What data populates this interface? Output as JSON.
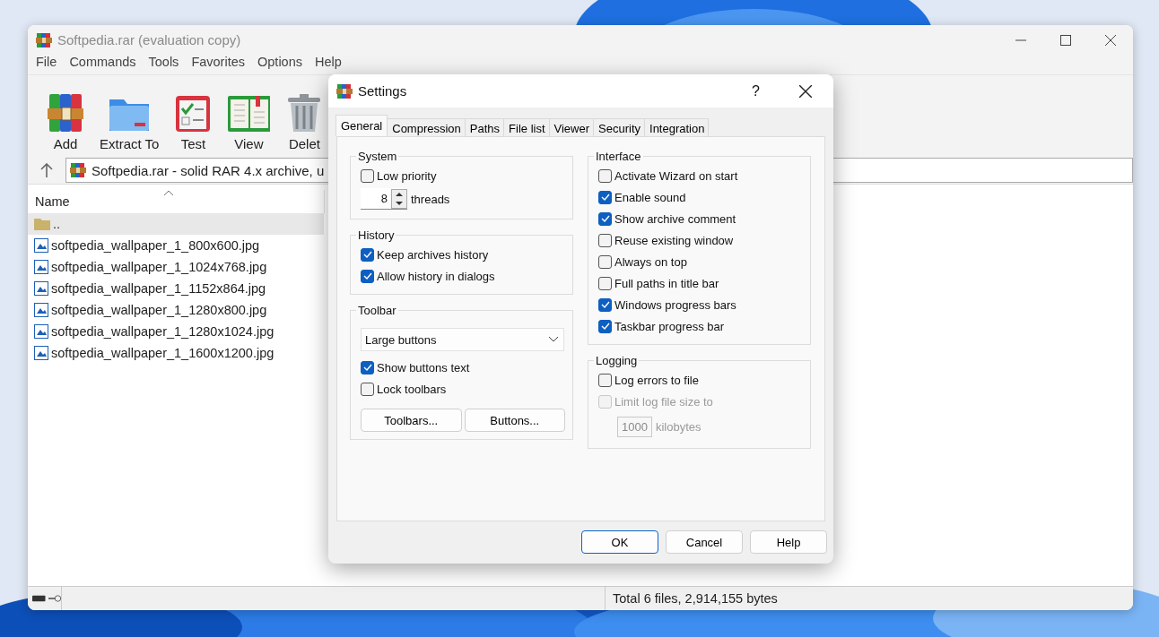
{
  "main_window": {
    "title": "Softpedia.rar (evaluation copy)",
    "menu": [
      "File",
      "Commands",
      "Tools",
      "Favorites",
      "Options",
      "Help"
    ],
    "toolbar": [
      {
        "label": "Add",
        "kind": "add"
      },
      {
        "label": "Extract To",
        "kind": "extract"
      },
      {
        "label": "Test",
        "kind": "test"
      },
      {
        "label": "View",
        "kind": "view"
      },
      {
        "label": "Delet",
        "kind": "delete"
      }
    ],
    "address": "Softpedia.rar - solid RAR 4.x archive, u",
    "columns": [
      "Name"
    ],
    "files": [
      {
        "name": "..",
        "kind": "folder",
        "selected": true
      },
      {
        "name": "softpedia_wallpaper_1_800x600.jpg",
        "kind": "image",
        "selected": false
      },
      {
        "name": "softpedia_wallpaper_1_1024x768.jpg",
        "kind": "image",
        "selected": false
      },
      {
        "name": "softpedia_wallpaper_1_1152x864.jpg",
        "kind": "image",
        "selected": false
      },
      {
        "name": "softpedia_wallpaper_1_1280x800.jpg",
        "kind": "image",
        "selected": false
      },
      {
        "name": "softpedia_wallpaper_1_1280x1024.jpg",
        "kind": "image",
        "selected": false
      },
      {
        "name": "softpedia_wallpaper_1_1600x1200.jpg",
        "kind": "image",
        "selected": false
      }
    ],
    "status": "Total 6 files, 2,914,155 bytes"
  },
  "dialog": {
    "title": "Settings",
    "help": "?",
    "tabs": [
      {
        "label": "General",
        "selected": true
      },
      {
        "label": "Compression",
        "selected": false
      },
      {
        "label": "Paths",
        "selected": false
      },
      {
        "label": "File list",
        "selected": false
      },
      {
        "label": "Viewer",
        "selected": false
      },
      {
        "label": "Security",
        "selected": false
      },
      {
        "label": "Integration",
        "selected": false
      }
    ],
    "columns": [
      {
        "groups": [
          {
            "title": "System",
            "items": [
              {
                "kind": "check",
                "label": "Low priority",
                "checked": false,
                "disabled": false
              },
              {
                "kind": "spin",
                "value": "8",
                "label": "threads"
              }
            ]
          },
          {
            "title": "History",
            "items": [
              {
                "kind": "check",
                "label": "Keep archives history",
                "checked": true,
                "disabled": false
              },
              {
                "kind": "check",
                "label": "Allow history in dialogs",
                "checked": true,
                "disabled": false
              }
            ]
          },
          {
            "title": "Toolbar",
            "items": [
              {
                "kind": "select",
                "value": "Large buttons"
              },
              {
                "kind": "check",
                "label": "Show buttons text",
                "checked": true,
                "disabled": false
              },
              {
                "kind": "check",
                "label": "Lock toolbars",
                "checked": false,
                "disabled": false
              },
              {
                "kind": "buttons",
                "buttons": [
                  "Toolbars...",
                  "Buttons..."
                ]
              }
            ]
          }
        ]
      },
      {
        "groups": [
          {
            "title": "Interface",
            "items": [
              {
                "kind": "check",
                "label": "Activate Wizard on start",
                "checked": false,
                "disabled": false
              },
              {
                "kind": "check",
                "label": "Enable sound",
                "checked": true,
                "disabled": false
              },
              {
                "kind": "check",
                "label": "Show archive comment",
                "checked": true,
                "disabled": false
              },
              {
                "kind": "check",
                "label": "Reuse existing window",
                "checked": false,
                "disabled": false
              },
              {
                "kind": "check",
                "label": "Always on top",
                "checked": false,
                "disabled": false
              },
              {
                "kind": "check",
                "label": "Full paths in title bar",
                "checked": false,
                "disabled": false
              },
              {
                "kind": "check",
                "label": "Windows progress bars",
                "checked": true,
                "disabled": false
              },
              {
                "kind": "check",
                "label": "Taskbar progress bar",
                "checked": true,
                "disabled": false
              }
            ]
          },
          {
            "title": "Logging",
            "items": [
              {
                "kind": "check",
                "label": "Log errors to file",
                "checked": false,
                "disabled": false
              },
              {
                "kind": "check",
                "label": "Limit log file size to",
                "checked": false,
                "disabled": true
              },
              {
                "kind": "field",
                "value": "1000",
                "label": "kilobytes",
                "disabled": true
              }
            ]
          }
        ]
      }
    ],
    "buttons": [
      {
        "label": "OK",
        "default": true
      },
      {
        "label": "Cancel",
        "default": false
      },
      {
        "label": "Help",
        "default": false
      }
    ]
  }
}
